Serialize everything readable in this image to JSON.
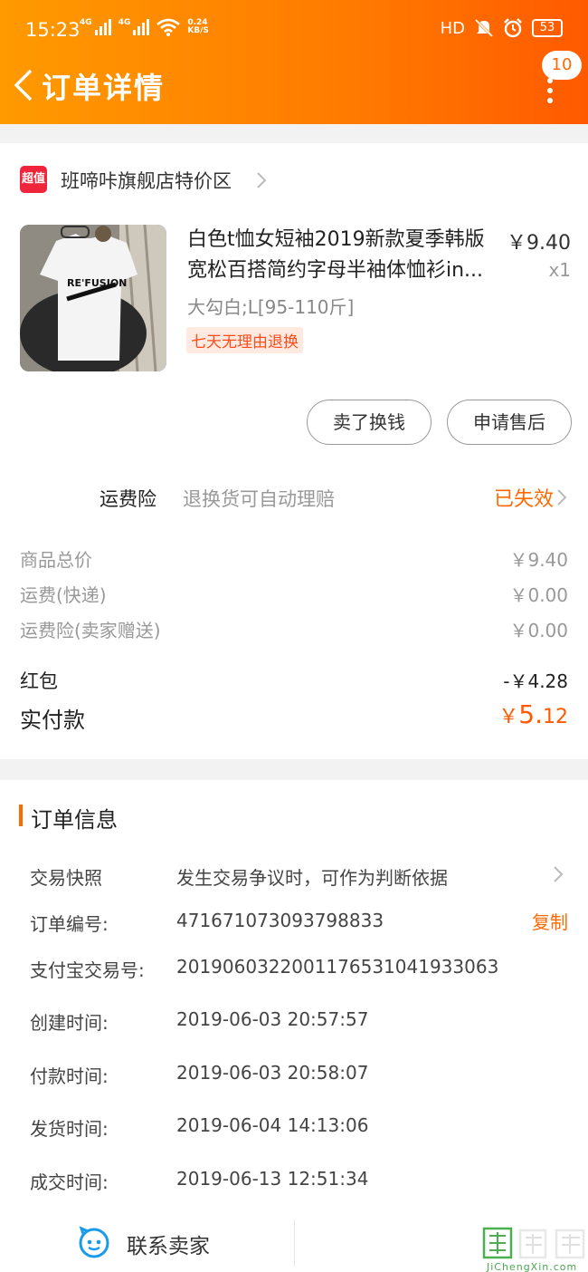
{
  "status_bar": {
    "time": "15:23",
    "net1": "4G",
    "net2": "4G",
    "speed_value": "0.24",
    "speed_unit": "KB/S",
    "hd": "HD",
    "battery": "53"
  },
  "header": {
    "title": "订单详情",
    "message_count": "10"
  },
  "store": {
    "logo_text": "超值",
    "name": "班啼咔旗舰店特价区"
  },
  "product": {
    "image_text": "RE'FUSION",
    "title": "白色t恤女短袖2019新款夏季韩版宽松百搭简约字母半袖体恤衫in...",
    "price": "￥9.40",
    "quantity": "x1",
    "sku": "大勾白;L[95-110斤]",
    "tag": "七天无理由退换"
  },
  "actions": {
    "sell": "卖了换钱",
    "after_sales": "申请售后"
  },
  "insurance": {
    "label": "运费险",
    "desc": "退换货可自动理赔",
    "status": "已失效"
  },
  "summary": {
    "goods_total_label": "商品总价",
    "goods_total": "￥9.40",
    "shipping_label": "运费(快递)",
    "shipping": "￥0.00",
    "insurance_label": "运费险(卖家赠送)",
    "insurance": "￥0.00",
    "redpacket_label": "红包",
    "redpacket": "-￥4.28",
    "paid_label": "实付款",
    "paid_currency": "￥",
    "paid_int": "5.",
    "paid_dec": "12"
  },
  "order_info": {
    "section_title": "订单信息",
    "snapshot_label": "交易快照",
    "snapshot_value": "发生交易争议时，可作为判断依据",
    "order_no_label": "订单编号:",
    "order_no": "471671073093798833",
    "copy": "复制",
    "alipay_label": "支付宝交易号:",
    "alipay_no": "2019060322001176531041933063",
    "created_label": "创建时间:",
    "created": "2019-06-03 20:57:57",
    "paid_label": "付款时间:",
    "paid": "2019-06-03 20:58:07",
    "shipped_label": "发货时间:",
    "shipped": "2019-06-04 14:13:06",
    "completed_label": "成交时间:",
    "completed": "2019-06-13 12:51:34"
  },
  "bottom_bar": {
    "contact": "联系卖家"
  },
  "watermark": {
    "text": "JiChengXin.com"
  },
  "colors": {
    "header_start": "#ff9a00",
    "header_end": "#ff5a00",
    "accent": "#ff6a00",
    "store_logo": "#f0253b"
  }
}
